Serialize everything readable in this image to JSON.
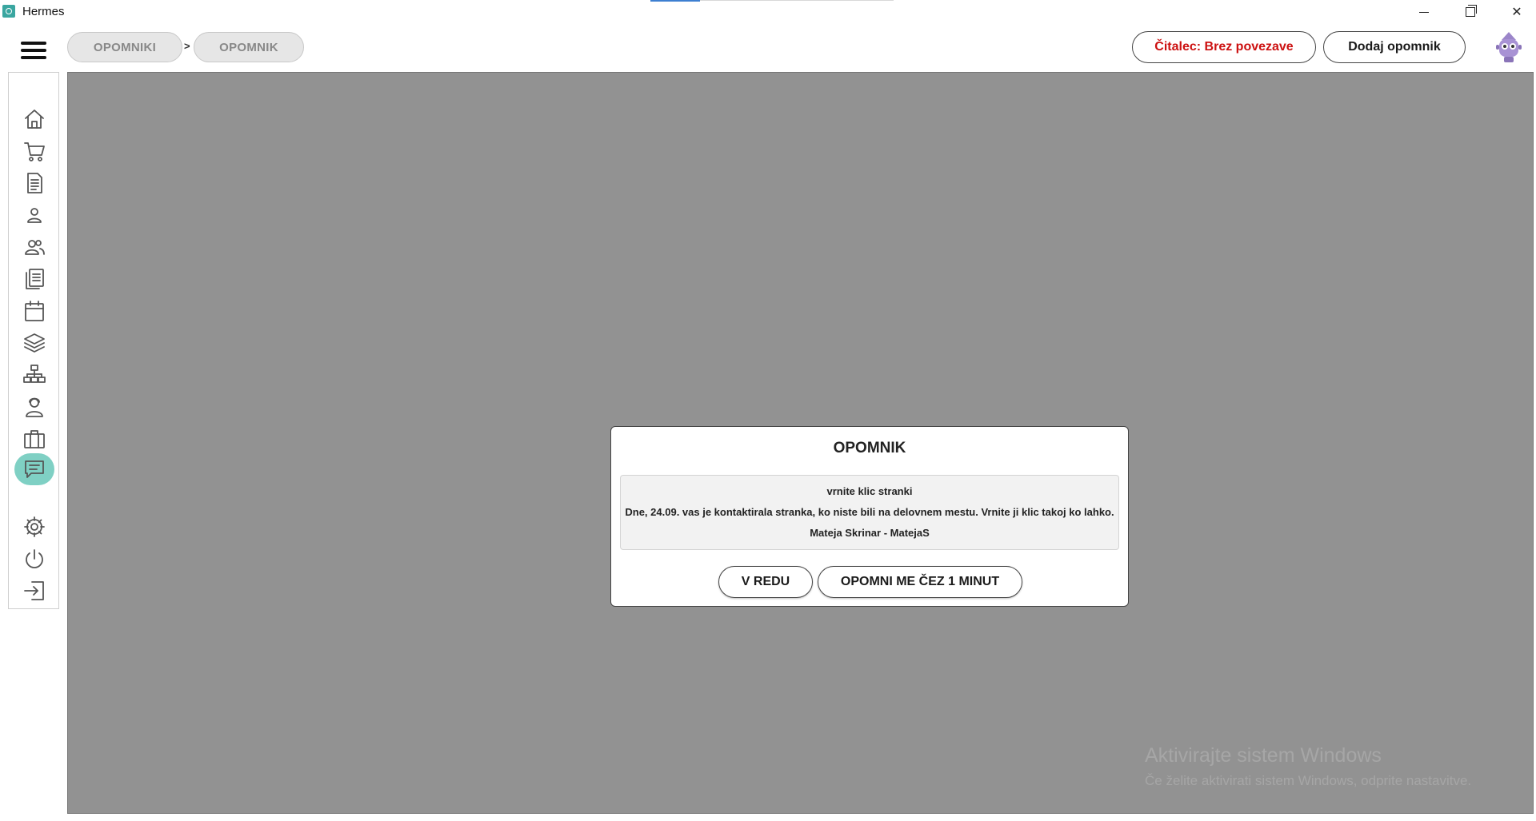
{
  "window": {
    "title": "Hermes",
    "controls": {
      "minimize": "minimize",
      "maximize": "restore",
      "close": "close"
    }
  },
  "header": {
    "breadcrumb": [
      "OPOMNIKI",
      "OPOMNIK"
    ],
    "breadcrumb_separator": ">",
    "reader_status_label": "Čitalec: Brez povezave",
    "add_reminder_label": "Dodaj opomnik"
  },
  "sidebar": {
    "items": [
      {
        "icon": "home-icon"
      },
      {
        "icon": "cart-icon"
      },
      {
        "icon": "document-icon"
      },
      {
        "icon": "person-icon"
      },
      {
        "icon": "people-icon"
      },
      {
        "icon": "documents-icon"
      },
      {
        "icon": "calendar-icon"
      },
      {
        "icon": "layers-icon"
      },
      {
        "icon": "network-icon"
      },
      {
        "icon": "operator-icon"
      },
      {
        "icon": "briefcase-icon"
      },
      {
        "icon": "chat-icon",
        "active": true
      }
    ],
    "bottom_items": [
      {
        "icon": "gear-icon"
      },
      {
        "icon": "power-icon"
      },
      {
        "icon": "logout-icon"
      }
    ]
  },
  "dialog": {
    "title": "OPOMNIK",
    "message_subject": "vrnite klic stranki",
    "message_body": "Dne, 24.09. vas je kontaktirala stranka, ko niste bili na delovnem mestu. Vrnite ji klic takoj ko lahko.",
    "message_author": "Mateja Skrinar - MatejaS",
    "ok_label": "V REDU",
    "remind_label": "OPOMNI ME ČEZ 1 MINUT"
  },
  "watermark": {
    "line1": "Aktivirajte sistem Windows",
    "line2": "Če želite aktivirati sistem Windows, odprite nastavitve."
  },
  "colors": {
    "accent": "#7fd0c4",
    "reader_status": "#cc1010",
    "overlay": "#929292"
  }
}
